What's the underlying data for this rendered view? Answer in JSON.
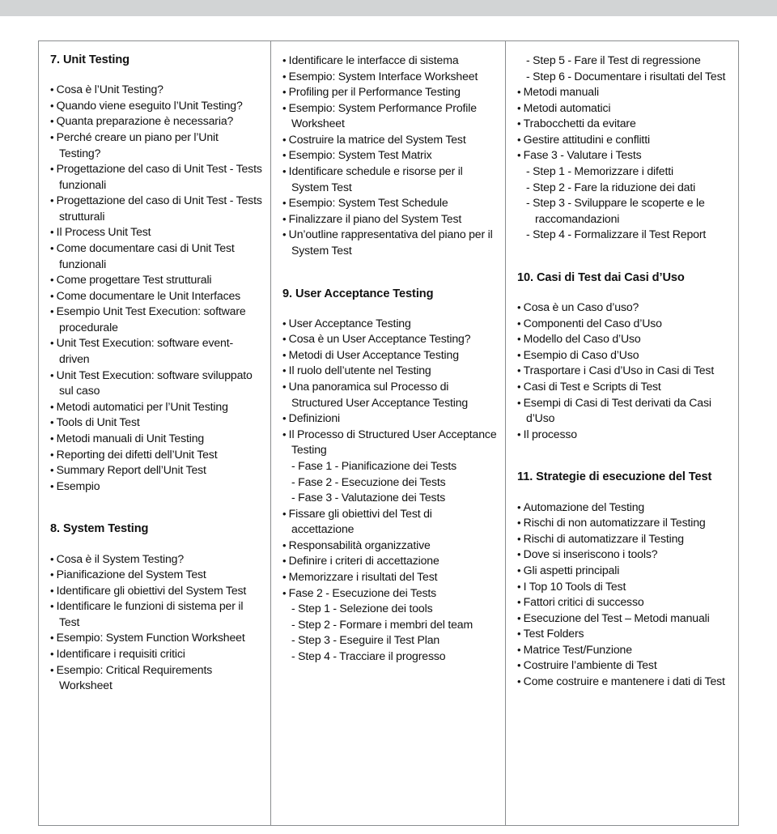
{
  "document": {
    "type": "table-of-contents",
    "language": "it",
    "columns": [
      {
        "id": "column-1",
        "blocks": [
          {
            "kind": "heading",
            "number": "7.",
            "title": "Unit Testing"
          },
          {
            "kind": "list",
            "items": [
              {
                "level": "bullet",
                "text": "Cosa è l’Unit Testing?"
              },
              {
                "level": "bullet",
                "text": "Quando viene eseguito l’Unit Testing?"
              },
              {
                "level": "bullet",
                "text": "Quanta preparazione è necessaria?"
              },
              {
                "level": "bullet",
                "text": "Perché creare un piano per l’Unit Testing?"
              },
              {
                "level": "bullet",
                "text": "Progettazione del caso di Unit Test - Tests funzionali"
              },
              {
                "level": "bullet",
                "text": "Progettazione del caso di Unit Test - Tests strutturali"
              },
              {
                "level": "bullet",
                "text": "Il Process Unit Test"
              },
              {
                "level": "bullet",
                "text": "Come documentare casi di Unit Test funzionali"
              },
              {
                "level": "bullet",
                "text": "Come progettare Test strutturali"
              },
              {
                "level": "bullet",
                "text": "Come documentare le Unit Interfaces"
              },
              {
                "level": "bullet",
                "text": "Esempio Unit Test Execution: software procedurale"
              },
              {
                "level": "bullet",
                "text": "Unit Test Execution: software event-driven"
              },
              {
                "level": "bullet",
                "text": "Unit Test Execution: software sviluppato sul caso"
              },
              {
                "level": "bullet",
                "text": "Metodi automatici per l’Unit Testing"
              },
              {
                "level": "bullet",
                "text": "Tools di Unit Test"
              },
              {
                "level": "bullet",
                "text": "Metodi manuali di Unit Testing"
              },
              {
                "level": "bullet",
                "text": "Reporting dei difetti dell’Unit Test"
              },
              {
                "level": "bullet",
                "text": "Summary Report dell’Unit Test"
              },
              {
                "level": "bullet",
                "text": "Esempio"
              }
            ]
          },
          {
            "kind": "heading",
            "number": "8.",
            "title": "System Testing",
            "spaced": true
          },
          {
            "kind": "list",
            "items": [
              {
                "level": "bullet",
                "text": "Cosa è il System Testing?"
              },
              {
                "level": "bullet",
                "text": "Pianificazione del System Test"
              },
              {
                "level": "bullet",
                "text": "Identificare gli obiettivi del System Test"
              },
              {
                "level": "bullet",
                "text": "Identificare le funzioni di sistema per il Test"
              },
              {
                "level": "bullet",
                "text": "Esempio: System Function Worksheet"
              },
              {
                "level": "bullet",
                "text": "Identificare i requisiti critici"
              },
              {
                "level": "bullet",
                "text": "Esempio: Critical Requirements Worksheet"
              }
            ]
          }
        ]
      },
      {
        "id": "column-2",
        "blocks": [
          {
            "kind": "list",
            "items": [
              {
                "level": "bullet",
                "text": "Identificare le interfacce di sistema"
              },
              {
                "level": "bullet",
                "text": "Esempio: System Interface Worksheet"
              },
              {
                "level": "bullet",
                "text": "Profiling per il Performance Testing"
              },
              {
                "level": "bullet",
                "text": "Esempio: System Performance Profile Worksheet"
              },
              {
                "level": "bullet",
                "text": "Costruire la matrice del System Test"
              },
              {
                "level": "bullet",
                "text": "Esempio: System Test Matrix"
              },
              {
                "level": "bullet",
                "text": "Identificare schedule e risorse per il System Test"
              },
              {
                "level": "bullet",
                "text": "Esempio: System Test Schedule"
              },
              {
                "level": "bullet",
                "text": "Finalizzare il piano del System Test"
              },
              {
                "level": "bullet",
                "text": "Un’outline rappresentativa del piano per il System Test"
              }
            ]
          },
          {
            "kind": "heading",
            "number": "9.",
            "title": "User Acceptance Testing",
            "spaced": true
          },
          {
            "kind": "list",
            "items": [
              {
                "level": "bullet",
                "text": "User Acceptance Testing"
              },
              {
                "level": "bullet",
                "text": "Cosa è un User Acceptance Testing?"
              },
              {
                "level": "bullet",
                "text": "Metodi di User Acceptance Testing"
              },
              {
                "level": "bullet",
                "text": "Il ruolo dell’utente nel Testing"
              },
              {
                "level": "bullet",
                "text": "Una panoramica sul Processo di Structured User Acceptance Testing"
              },
              {
                "level": "bullet",
                "text": "Definizioni"
              },
              {
                "level": "bullet",
                "text": "Il Processo di Structured User Acceptance Testing"
              },
              {
                "level": "sub",
                "text": "- Fase 1 - Pianificazione dei Tests"
              },
              {
                "level": "sub",
                "text": "- Fase 2 - Esecuzione dei Tests"
              },
              {
                "level": "sub",
                "text": "- Fase 3 - Valutazione dei Tests"
              },
              {
                "level": "bullet",
                "text": "Fissare gli obiettivi del Test di accettazione"
              },
              {
                "level": "bullet",
                "text": "Responsabilità organizzative"
              },
              {
                "level": "bullet",
                "text": "Definire i criteri di accettazione"
              },
              {
                "level": "bullet",
                "text": "Memorizzare i risultati del Test"
              },
              {
                "level": "bullet",
                "text": "Fase 2 - Esecuzione dei Tests"
              },
              {
                "level": "sub",
                "text": "- Step 1 - Selezione dei tools"
              },
              {
                "level": "sub",
                "text": "- Step 2 - Formare i membri del team"
              },
              {
                "level": "sub",
                "text": "- Step 3 - Eseguire il Test Plan"
              },
              {
                "level": "sub",
                "text": "- Step 4 - Tracciare il progresso"
              }
            ]
          }
        ]
      },
      {
        "id": "column-3",
        "blocks": [
          {
            "kind": "list",
            "items": [
              {
                "level": "sub",
                "text": "- Step 5 - Fare il Test di regressione"
              },
              {
                "level": "sub",
                "text": "- Step 6 - Documentare i risultati del Test"
              },
              {
                "level": "bullet",
                "text": "Metodi manuali"
              },
              {
                "level": "bullet",
                "text": "Metodi automatici"
              },
              {
                "level": "bullet",
                "text": "Trabocchetti da evitare"
              },
              {
                "level": "bullet",
                "text": "Gestire attitudini e conflitti"
              },
              {
                "level": "bullet",
                "text": "Fase 3 - Valutare i Tests"
              },
              {
                "level": "sub",
                "text": "- Step 1 - Memorizzare i difetti"
              },
              {
                "level": "sub",
                "text": "- Step 2 - Fare la riduzione dei dati"
              },
              {
                "level": "sub",
                "text": "- Step 3 - Sviluppare le scoperte e le raccomandazioni"
              },
              {
                "level": "sub",
                "text": "- Step 4 - Formalizzare il Test Report"
              }
            ]
          },
          {
            "kind": "heading",
            "number": "10.",
            "title": "Casi di Test dai Casi d’Uso",
            "spaced": true
          },
          {
            "kind": "list",
            "items": [
              {
                "level": "bullet",
                "text": "Cosa è un Caso d’uso?"
              },
              {
                "level": "bullet",
                "text": "Componenti del Caso d’Uso"
              },
              {
                "level": "bullet",
                "text": "Modello del Caso d’Uso"
              },
              {
                "level": "bullet",
                "text": "Esempio di Caso d’Uso"
              },
              {
                "level": "bullet",
                "text": "Trasportare i Casi d’Uso in Casi di Test"
              },
              {
                "level": "bullet",
                "text": "Casi di Test e Scripts di Test"
              },
              {
                "level": "bullet",
                "text": "Esempi di Casi di Test derivati da Casi d’Uso"
              },
              {
                "level": "bullet",
                "text": "Il processo"
              }
            ]
          },
          {
            "kind": "heading",
            "number": "11.",
            "title": "Strategie di esecuzione del Test",
            "spaced": true
          },
          {
            "kind": "list",
            "items": [
              {
                "level": "bullet",
                "text": "Automazione del Testing"
              },
              {
                "level": "bullet",
                "text": "Rischi di non automatizzare il Testing"
              },
              {
                "level": "bullet",
                "text": "Rischi di automatizzare il Testing"
              },
              {
                "level": "bullet",
                "text": "Dove si inseriscono i tools?"
              },
              {
                "level": "bullet",
                "text": "Gli aspetti principali"
              },
              {
                "level": "bullet",
                "text": "I Top 10 Tools di Test"
              },
              {
                "level": "bullet",
                "text": "Fattori critici di successo"
              },
              {
                "level": "bullet",
                "text": "Esecuzione del Test – Metodi manuali"
              },
              {
                "level": "bullet",
                "text": "Test Folders"
              },
              {
                "level": "bullet",
                "text": "Matrice Test/Funzione"
              },
              {
                "level": "bullet",
                "text": "Costruire l’ambiente di Test"
              },
              {
                "level": "bullet",
                "text": "Come costruire e mantenere i dati di Test"
              }
            ]
          }
        ]
      }
    ]
  },
  "colors": {
    "page_background": "#ffffff",
    "top_band": "#d2d4d5",
    "table_border": "#8a8d8f",
    "text": "#111111"
  }
}
